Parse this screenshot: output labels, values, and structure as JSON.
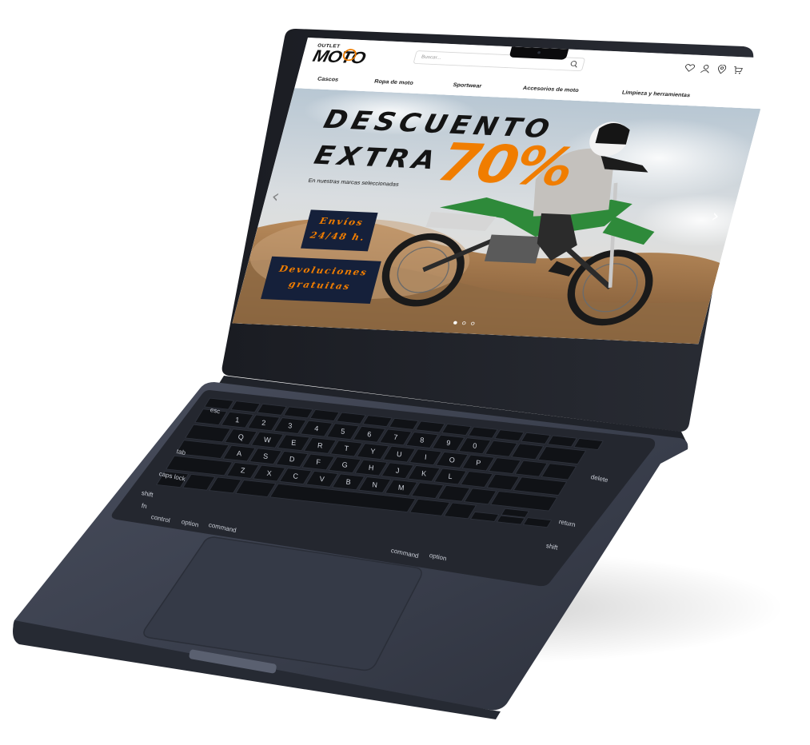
{
  "site": {
    "logo_small": "OUTLET",
    "logo_big": "MOTO",
    "search_placeholder": "Buscar..."
  },
  "header_icons": [
    "heart-icon",
    "user-icon",
    "location-pin-icon",
    "cart-icon"
  ],
  "nav": {
    "items": [
      "Cascos",
      "Ropa de moto",
      "Sportwear",
      "Accesorios de moto",
      "Limpieza y herramientas"
    ]
  },
  "hero": {
    "title_line1": "DESCUENTO",
    "title_line2": "EXTRA",
    "discount": "70%",
    "subtitle": "En nuestras marcas seleccionadas",
    "promo_shipping": [
      "Envíos",
      "24/48 h."
    ],
    "promo_returns": [
      "Devoluciones",
      "gratuitas"
    ],
    "arrow_left": "‹",
    "arrow_right": "›",
    "slides_count": 3,
    "active_slide": 1
  },
  "keyboard": {
    "labels": {
      "esc": "esc",
      "tab": "tab",
      "caps": "caps lock",
      "shift_left": "shift",
      "fn": "fn",
      "control": "control",
      "option_left": "option",
      "command_left": "command",
      "command_right": "command",
      "option_right": "option",
      "delete": "delete",
      "return": "return",
      "shift_right": "shift"
    },
    "row_number": [
      "1",
      "2",
      "3",
      "4",
      "5",
      "6",
      "7",
      "8",
      "9",
      "0"
    ],
    "row_q": [
      "Q",
      "W",
      "E",
      "R",
      "T",
      "Y",
      "U",
      "I",
      "O",
      "P"
    ],
    "row_a": [
      "A",
      "S",
      "D",
      "F",
      "G",
      "H",
      "J",
      "K",
      "L"
    ],
    "row_z": [
      "Z",
      "X",
      "C",
      "V",
      "B",
      "N",
      "M"
    ]
  },
  "colors": {
    "accent_orange": "#f07d00",
    "promo_navy": "#15203a",
    "laptop_body": "#3a3f4e"
  }
}
